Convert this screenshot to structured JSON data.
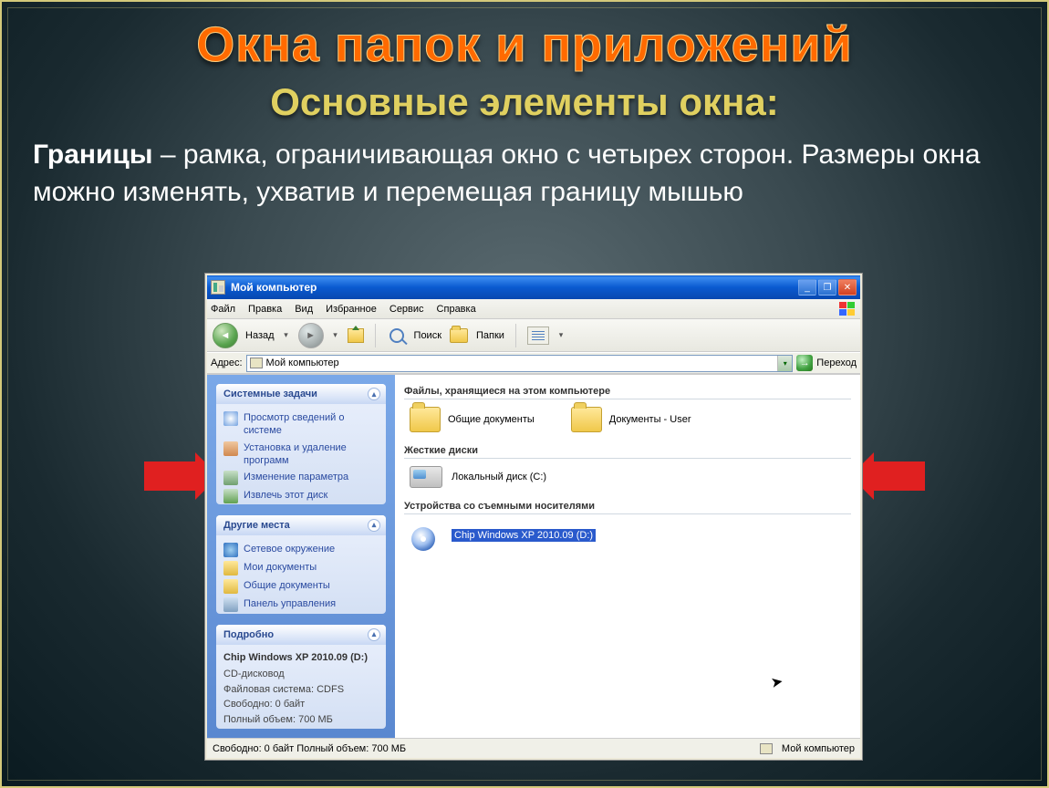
{
  "slide": {
    "title_main": "Окна папок и приложений",
    "title_sub": "Основные элементы окна:",
    "paragraph_term": "Границы",
    "paragraph_rest": " – рамка, ограничивающая окно с четырех сторон. Размеры окна можно изменять, ухватив и перемещая границу мышью"
  },
  "window": {
    "title": "Мой компьютер",
    "menus": [
      "Файл",
      "Правка",
      "Вид",
      "Избранное",
      "Сервис",
      "Справка"
    ],
    "toolbar": {
      "back": "Назад",
      "search": "Поиск",
      "folders": "Папки"
    },
    "address": {
      "label": "Адрес:",
      "value": "Мой компьютер",
      "go": "Переход"
    },
    "sidebar": {
      "panel1": {
        "title": "Системные задачи",
        "items": [
          "Просмотр сведений о системе",
          "Установка и удаление программ",
          "Изменение параметра",
          "Извлечь этот диск"
        ]
      },
      "panel2": {
        "title": "Другие места",
        "items": [
          "Сетевое окружение",
          "Мои документы",
          "Общие документы",
          "Панель управления"
        ]
      },
      "panel3": {
        "title": "Подробно",
        "detail_title": "Chip Windows XP 2010.09 (D:)",
        "lines": [
          "CD-дисковод",
          "Файловая система: CDFS",
          "Свободно: 0 байт",
          "Полный объем: 700 МБ"
        ]
      }
    },
    "main": {
      "section1": "Файлы, хранящиеся на этом компьютере",
      "folders": [
        "Общие документы",
        "Документы - User"
      ],
      "section2": "Жесткие диски",
      "drive": "Локальный диск (C:)",
      "section3": "Устройства со съемными носителями",
      "cd": "Chip Windows XP 2010.09 (D:)"
    },
    "status": {
      "left": "Свободно: 0 байт Полный объем: 700 МБ",
      "right": "Мой компьютер"
    }
  }
}
